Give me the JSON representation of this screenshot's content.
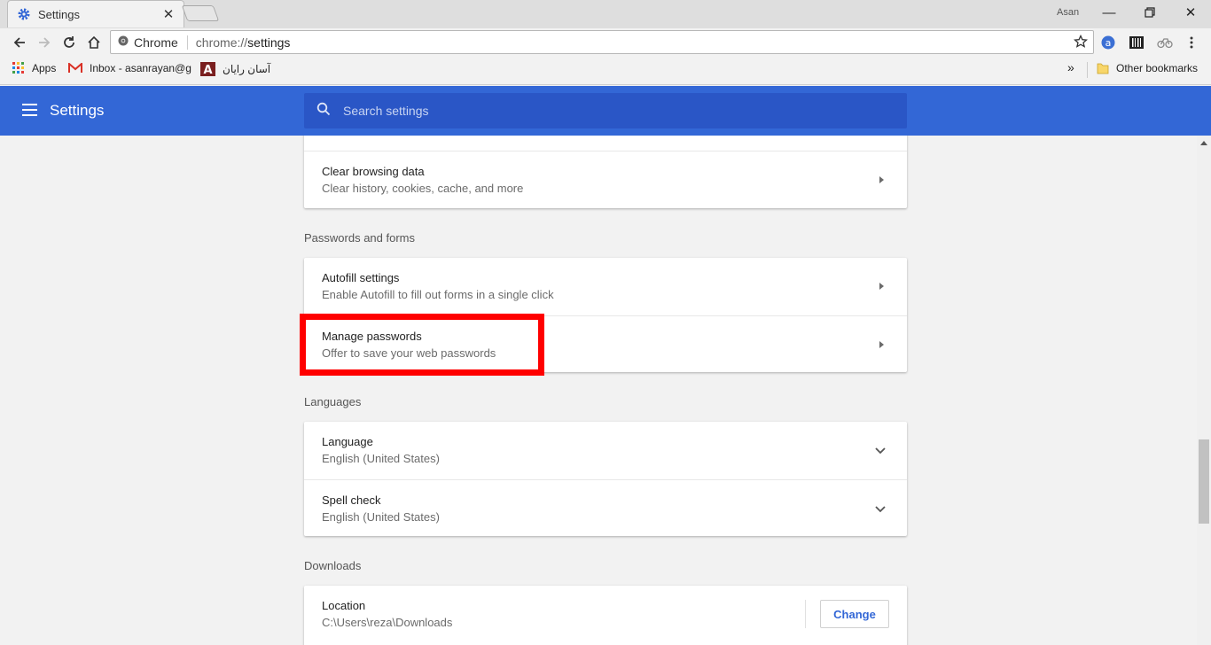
{
  "browser": {
    "tab_title": "Settings",
    "profile_name": "Asan",
    "omnibox_chip": "Chrome",
    "url_scheme": "chrome://",
    "url_path": "settings"
  },
  "bookmarks": {
    "apps": "Apps",
    "gmail": "Inbox - asanrayan@g",
    "asan": "آسان رایان",
    "more": "»",
    "other": "Other bookmarks"
  },
  "header": {
    "title": "Settings",
    "search_placeholder": "Search settings"
  },
  "privacy": {
    "clear_title": "Clear browsing data",
    "clear_sub": "Clear history, cookies, cache, and more"
  },
  "passwords_forms": {
    "section": "Passwords and forms",
    "autofill_title": "Autofill settings",
    "autofill_sub": "Enable Autofill to fill out forms in a single click",
    "manage_title": "Manage passwords",
    "manage_sub": "Offer to save your web passwords"
  },
  "languages": {
    "section": "Languages",
    "language_title": "Language",
    "language_value": "English (United States)",
    "spell_title": "Spell check",
    "spell_value": "English (United States)"
  },
  "downloads": {
    "section": "Downloads",
    "location_title": "Location",
    "location_value": "C:\\Users\\reza\\Downloads",
    "change_label": "Change"
  },
  "colors": {
    "accent": "#3367d6",
    "highlight": "#ff0000"
  }
}
